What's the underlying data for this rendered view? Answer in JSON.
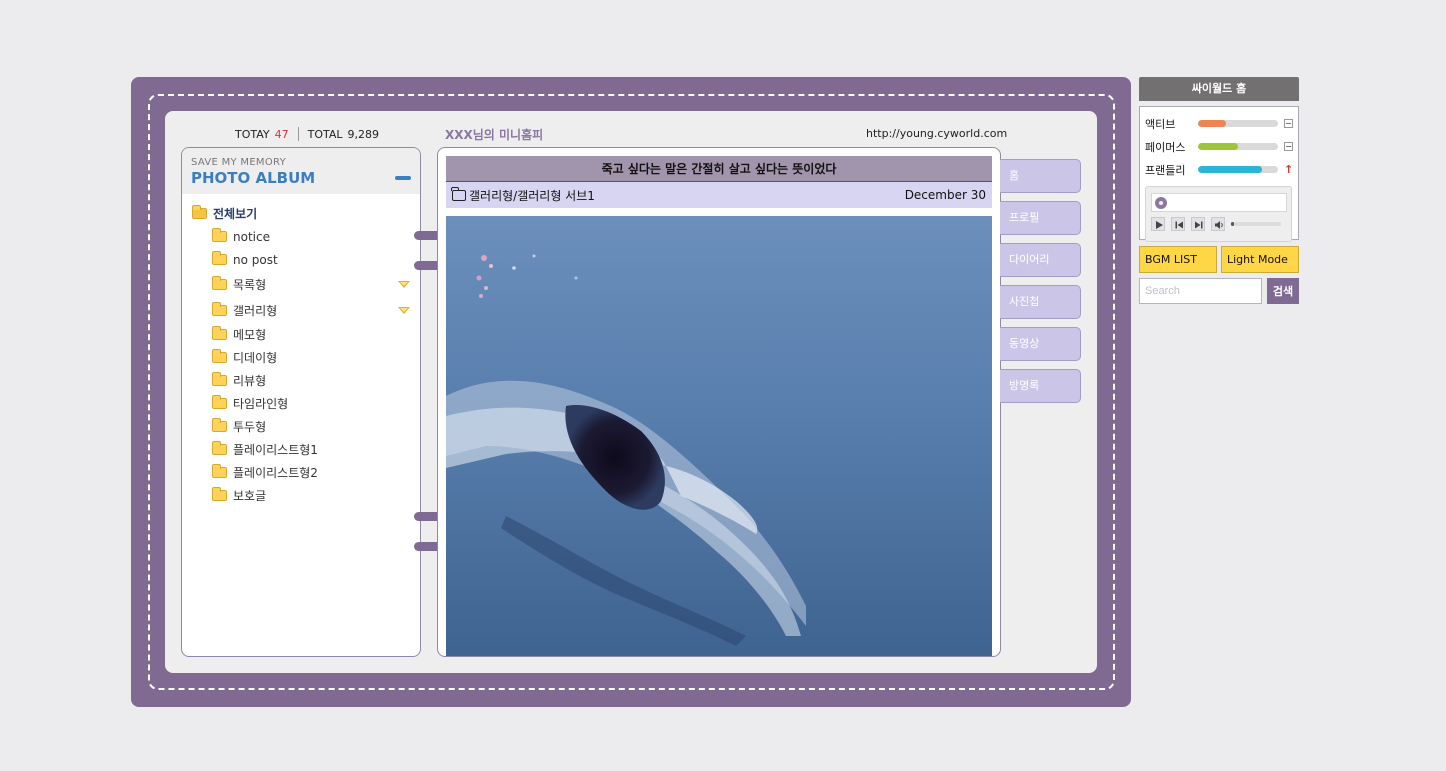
{
  "counter": {
    "today_label": "TOTAY",
    "today_value": "47",
    "total_label": "TOTAL",
    "total_value": "9,289"
  },
  "header": {
    "title": "XXX님의 미니홈피",
    "url": "http://young.cyworld.com"
  },
  "album": {
    "subtitle": "SAVE MY MEMORY",
    "title": "PHOTO ALBUM",
    "all_label": "전체보기",
    "folders": [
      "notice",
      "no post",
      "목록형",
      "갤러리형",
      "메모형",
      "디데이형",
      "리뷰형",
      "타임라인형",
      "투두형",
      "플레이리스트형1",
      "플레이리스트형2",
      "보호글"
    ]
  },
  "post": {
    "title": "죽고 싶다는 말은 간절히 살고 싶다는 뜻이었다",
    "path": "갤러리형/갤러리형 서브1",
    "date": "December 30"
  },
  "tabs": [
    "홈",
    "프로필",
    "다이어리",
    "사진첩",
    "동영상",
    "방명록"
  ],
  "sidebar": {
    "home_label": "싸이월드 홈",
    "stats": [
      {
        "label": "액티브",
        "value": 0.35,
        "color": "#ee8354",
        "button": "−"
      },
      {
        "label": "페이머스",
        "value": 0.5,
        "color": "#9dc53c",
        "button": "−"
      },
      {
        "label": "프랜들리",
        "value": 0.8,
        "color": "#27b6d8",
        "button": "↑"
      }
    ],
    "bgm_label": "BGM LIST",
    "light_label": "Light Mode",
    "search_placeholder": "Search",
    "search_button": "검색"
  }
}
